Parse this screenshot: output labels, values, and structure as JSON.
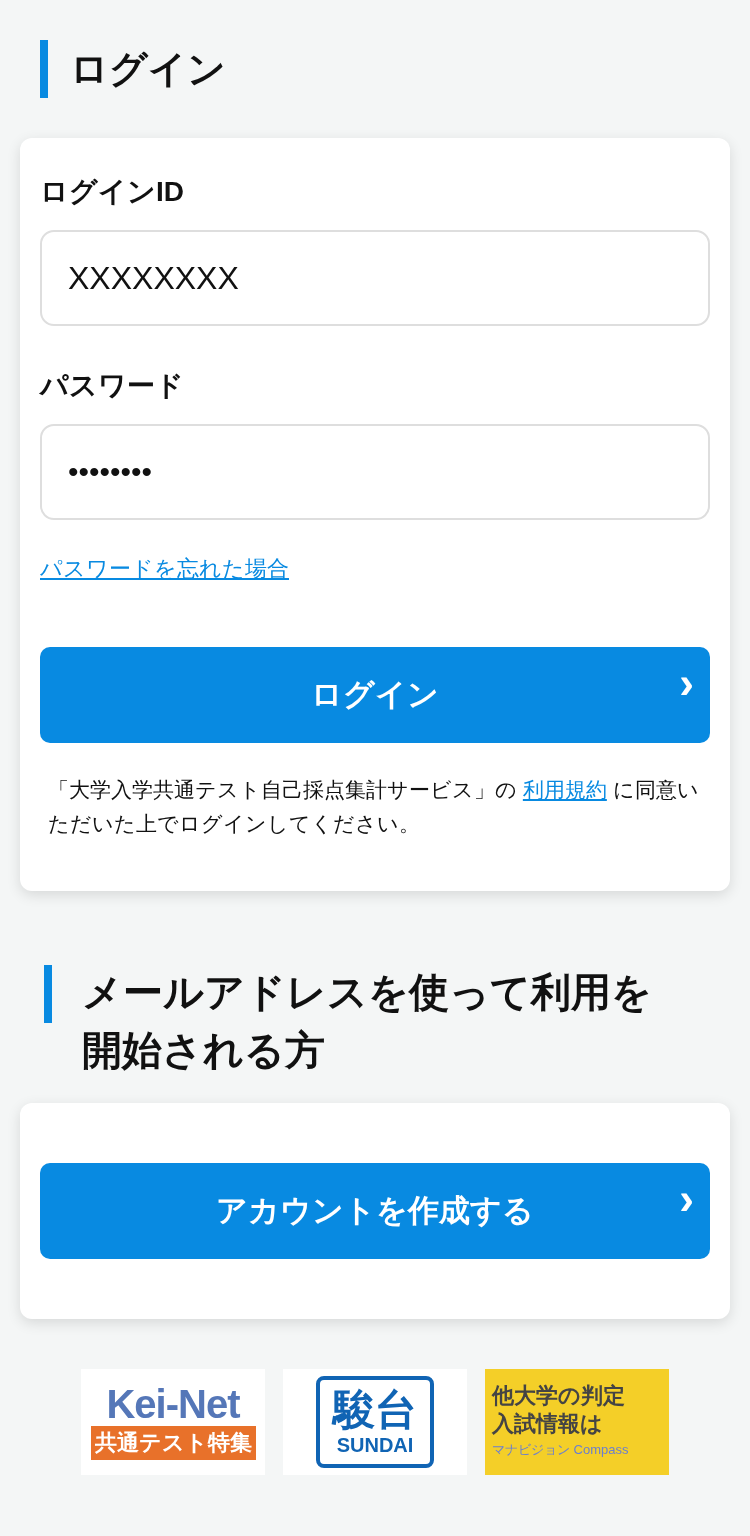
{
  "login_section": {
    "title": "ログイン",
    "fields": [
      {
        "label": "ログインID",
        "value": "XXXXXXXX"
      },
      {
        "label": "パスワード",
        "value": "••••••••"
      }
    ],
    "forgot_link": "パスワードを忘れた場合",
    "submit_button": {
      "label": "ログイン",
      "chevron": "›"
    },
    "agreement": {
      "before": "「大学入学共通テスト自己採点集計サービス」の ",
      "link": "利用規約",
      "after": " に同意いただいた上でログインしてください。"
    }
  },
  "signup_section": {
    "title": "メールアドレスを使って利用を開始される方",
    "button": {
      "label": "アカウントを作成する",
      "chevron": "›"
    }
  },
  "banners": [
    {
      "kind": "keinet",
      "lines": [
        "Kei-Net",
        "共通テスト特集"
      ]
    },
    {
      "kind": "sundai",
      "lines": [
        "駿台",
        "SUNDAI"
      ]
    },
    {
      "kind": "compass",
      "lines": [
        "他大学の判定",
        "入試情報は",
        "マナビジョン Compass"
      ]
    }
  ]
}
